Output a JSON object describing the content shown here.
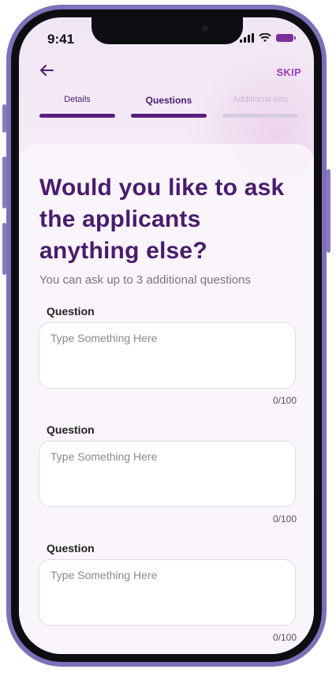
{
  "status": {
    "time": "9:41"
  },
  "nav": {
    "back_icon": "arrow-left-icon",
    "skip_label": "SKIP"
  },
  "steps": [
    {
      "label": "Details",
      "state": "done"
    },
    {
      "label": "Questions",
      "state": "active"
    },
    {
      "label": "Additional Info",
      "state": "upcoming"
    }
  ],
  "content": {
    "headline": "Would you like to ask the applicants anything else?",
    "subtext": "You can ask up to 3 additional questions"
  },
  "questions": [
    {
      "label": "Question",
      "placeholder": "Type Something Here",
      "counter": "0/100"
    },
    {
      "label": "Question",
      "placeholder": "Type Something Here",
      "counter": "0/100"
    },
    {
      "label": "Question",
      "placeholder": "Type Something Here",
      "counter": "0/100"
    }
  ],
  "colors": {
    "primary": "#4a1b6e",
    "accent": "#9a3bbf",
    "frame": "#7e70b8"
  }
}
